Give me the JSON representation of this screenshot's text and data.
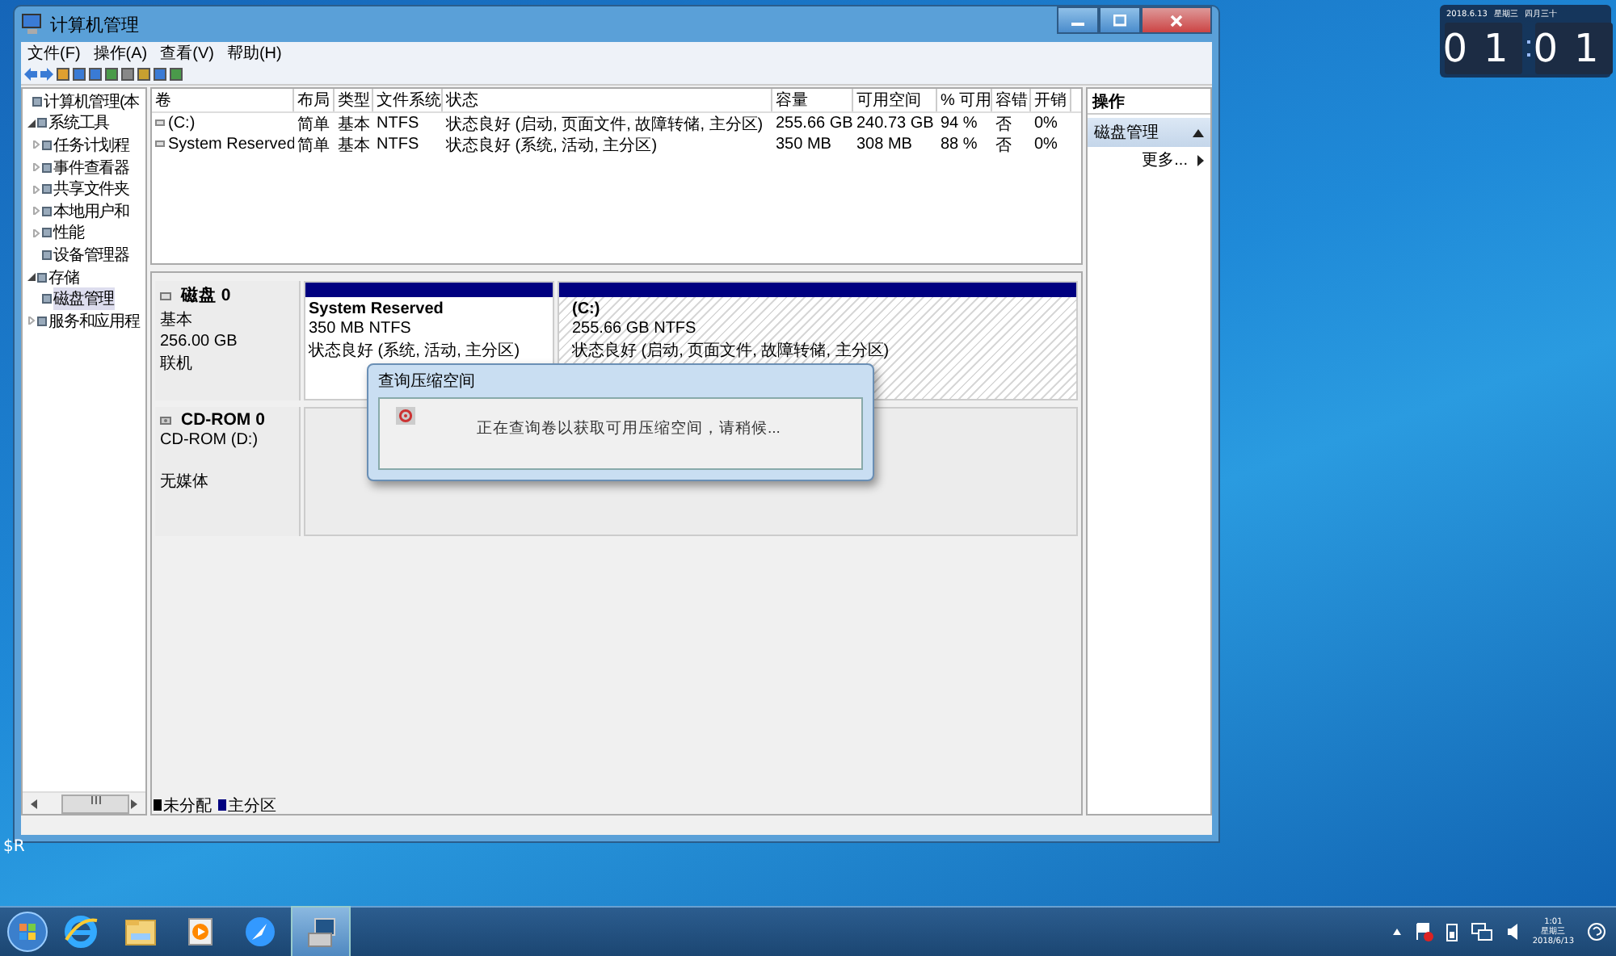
{
  "window": {
    "title": "计算机管理"
  },
  "menu": [
    "文件(F)",
    "操作(A)",
    "查看(V)",
    "帮助(H)"
  ],
  "tree": [
    {
      "label": "计算机管理(本",
      "selected": false,
      "children": [
        {
          "label": "系统工具",
          "expanded": true,
          "selected": false,
          "children": [
            {
              "label": "任务计划程",
              "expanded": false,
              "selected": false
            },
            {
              "label": "事件查看器",
              "expanded": false,
              "selected": false
            },
            {
              "label": "共享文件夹",
              "expanded": false,
              "selected": false
            },
            {
              "label": "本地用户和",
              "expanded": false,
              "selected": false
            },
            {
              "label": "性能",
              "expanded": false,
              "selected": false
            },
            {
              "label": "设备管理器",
              "selected": false
            }
          ]
        },
        {
          "label": "存储",
          "expanded": true,
          "selected": false,
          "children": [
            {
              "label": "磁盘管理",
              "selected": true
            }
          ]
        },
        {
          "label": "服务和应用程",
          "expanded": false,
          "selected": false
        }
      ]
    }
  ],
  "volumes": {
    "columns": [
      "卷",
      "布局",
      "类型",
      "文件系统",
      "状态",
      "容量",
      "可用空间",
      "% 可用",
      "容错",
      "开销"
    ],
    "rows": [
      [
        "(C:)",
        "简单",
        "基本",
        "NTFS",
        "状态良好 (启动, 页面文件, 故障转储, 主分区)",
        "255.66 GB",
        "240.73 GB",
        "94 %",
        "否",
        "0%"
      ],
      [
        "System Reserved",
        "简单",
        "基本",
        "NTFS",
        "状态良好 (系统, 活动, 主分区)",
        "350 MB",
        "308 MB",
        "88 %",
        "否",
        "0%"
      ]
    ]
  },
  "disks": [
    {
      "kind": "disk",
      "name": "磁盘 0",
      "lines": [
        "基本",
        "256.00 GB",
        "联机"
      ],
      "partitions": [
        {
          "name": "System Reserved",
          "size": "350 MB NTFS",
          "status": "状态良好 (系统, 活动, 主分区)",
          "selected": false
        },
        {
          "name": "(C:)",
          "size": "255.66 GB NTFS",
          "status": "状态良好 (启动, 页面文件, 故障转储, 主分区)",
          "selected": true
        }
      ]
    },
    {
      "kind": "cdrom",
      "name": "CD-ROM 0",
      "lines": [
        "CD-ROM (D:)",
        "无媒体"
      ]
    }
  ],
  "legend": [
    {
      "label": "未分配",
      "color": "#000000"
    },
    {
      "label": "主分区",
      "color": "#000080"
    }
  ],
  "dialog": {
    "title": "查询压缩空间",
    "message": "正在查询卷以获取可用压缩空间，请稍候..."
  },
  "actions": {
    "title": "操作",
    "sections": [
      {
        "title": "磁盘管理",
        "expanded": true,
        "items": [
          "更多..."
        ]
      }
    ]
  },
  "clock_widget": {
    "date": "2018.6.13",
    "weekday": "星期三",
    "lunar": "四月三十",
    "hours": "01",
    "minutes": "01"
  },
  "desktop_icons": [
    {
      "label": "$R"
    }
  ],
  "taskbar": {
    "apps": [
      {
        "kind": "browser",
        "selected": false
      },
      {
        "kind": "folder",
        "selected": false
      },
      {
        "kind": "media",
        "selected": false
      },
      {
        "kind": "globe",
        "selected": false
      },
      {
        "kind": "computer",
        "selected": true
      }
    ]
  },
  "tray": {
    "time": "1:01",
    "weekday": "星期三",
    "date": "2018/6/13"
  }
}
